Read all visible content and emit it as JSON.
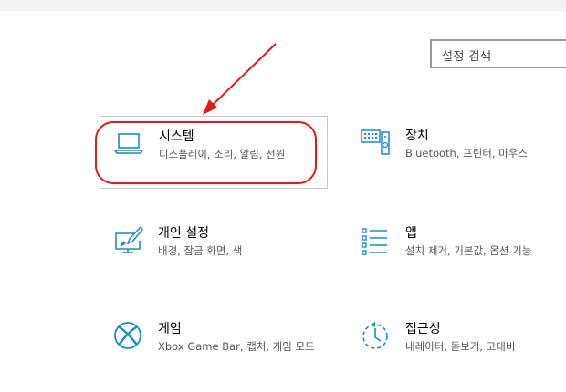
{
  "search": {
    "placeholder": "설정 검색"
  },
  "tiles": [
    {
      "title": "시스템",
      "subtitle": "디스플레이, 소리, 알림, 전원",
      "icon": "laptop-icon"
    },
    {
      "title": "장치",
      "subtitle": "Bluetooth, 프린터, 마우스",
      "icon": "devices-icon"
    },
    {
      "title": "개인 설정",
      "subtitle": "배경, 잠금 화면, 색",
      "icon": "personalization-icon"
    },
    {
      "title": "앱",
      "subtitle": "설치 제거, 기본값, 옵션 기능",
      "icon": "apps-list-icon"
    },
    {
      "title": "게임",
      "subtitle": "Xbox Game Bar, 캡처, 게임 모드",
      "icon": "xbox-icon"
    },
    {
      "title": "접근성",
      "subtitle": "내레이터, 돋보기, 고대비",
      "icon": "ease-of-access-icon"
    }
  ],
  "colors": {
    "accent": "#1a8cc8",
    "annotation": "#e01a1a"
  }
}
